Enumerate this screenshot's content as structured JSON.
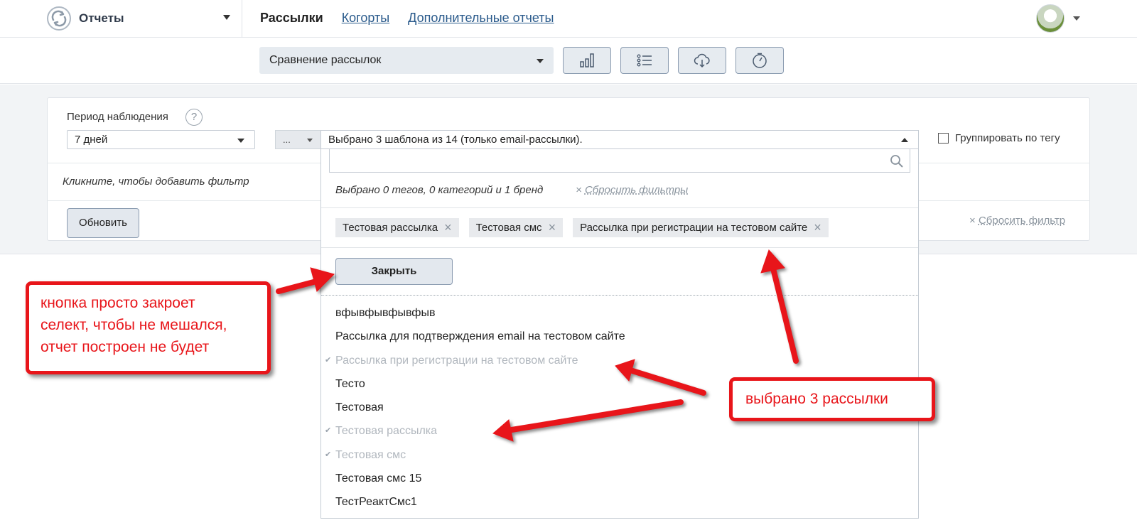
{
  "app": {
    "title": "Отчеты"
  },
  "nav": {
    "active": "Рассылки",
    "links": [
      "Когорты",
      "Дополнительные отчеты"
    ]
  },
  "toolbar": {
    "report_select": "Сравнение рассылок",
    "buttons": [
      "bar-chart-icon",
      "list-icon",
      "cloud-download-icon",
      "clock-icon"
    ]
  },
  "filters": {
    "period_label": "Период наблюдения",
    "help": "?",
    "period_value": "7 дней",
    "mini_select": "...",
    "add_filter": "Кликните, чтобы добавить фильтр",
    "update": "Обновить",
    "group_by_tag": "Группировать по тегу",
    "reset_filter": "Сбросить фильтр"
  },
  "multiselect": {
    "summary": "Выбрано 3 шаблона из 14 (только email-рассылки).",
    "search_placeholder": "",
    "counts": "Выбрано 0 тегов, 0 категорий и 1 бренд",
    "reset_filters": "Сбросить фильтры",
    "chips": [
      "Тестовая рассылка",
      "Тестовая смс",
      "Рассылка при регистрации на тестовом сайте"
    ],
    "close": "Закрыть",
    "options": [
      {
        "label": "вфывфывфывфыв",
        "selected": false
      },
      {
        "label": "Рассылка для подтверждения email на тестовом сайте",
        "selected": false
      },
      {
        "label": "Рассылка при регистрации на тестовом сайте",
        "selected": true
      },
      {
        "label": "Тесто",
        "selected": false
      },
      {
        "label": "Тестовая",
        "selected": false
      },
      {
        "label": "Тестовая рассылка",
        "selected": true
      },
      {
        "label": "Тестовая смс",
        "selected": true
      },
      {
        "label": "Тестовая смс 15",
        "selected": false
      },
      {
        "label": "ТестРеактСмс1",
        "selected": false
      }
    ]
  },
  "annotations": {
    "left_lines": [
      "кнопка просто закроет",
      "селект, чтобы не мешался,",
      "отчет построен не будет"
    ],
    "right": "выбрано 3 рассылки",
    "color": "#e8151a"
  }
}
